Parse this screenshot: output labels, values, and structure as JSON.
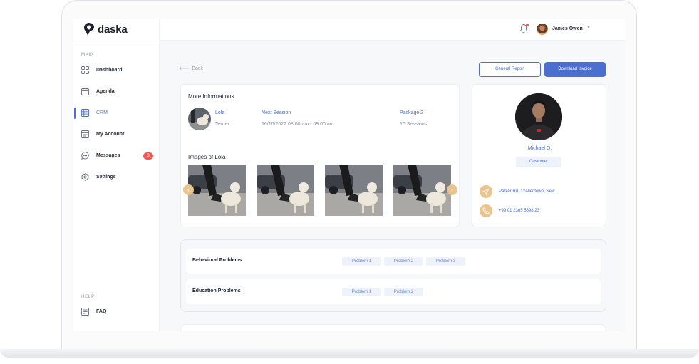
{
  "app": {
    "name": "daska"
  },
  "colors": {
    "accent": "#4a6fd0",
    "badge": "#ef5a57",
    "contact_icon": "#e9c48f",
    "tag_bg": "#eef2fb"
  },
  "sidebar": {
    "main_label": "MAIN",
    "items": [
      {
        "label": "Dashboard",
        "icon": "grid-icon"
      },
      {
        "label": "Agenda",
        "icon": "calendar-icon"
      },
      {
        "label": "CRM",
        "icon": "table-icon",
        "active": true
      },
      {
        "label": "My Account",
        "icon": "account-card-icon"
      },
      {
        "label": "Messages",
        "icon": "chat-icon",
        "badge": "3"
      },
      {
        "label": "Settings",
        "icon": "gear-icon"
      }
    ],
    "help_label": "HELP",
    "help_items": [
      {
        "label": "FAQ",
        "icon": "faq-icon"
      }
    ]
  },
  "header": {
    "user_name": "James Owen",
    "notification_icon": "bell-icon"
  },
  "toolbar": {
    "back_label": "Back",
    "general_report_label": "General Report",
    "download_invoice_label": "Download Invoice"
  },
  "more_info": {
    "title": "More Informations",
    "pet_name": "Lola",
    "pet_breed": "Terrier",
    "next_session_label": "Next Session",
    "next_session_value": "16/10/2022   08:00 am - 09:00 am",
    "package_label": "Package 2",
    "package_value": "10 Sessions",
    "gallery_title": "Images of Lola",
    "gallery_count": 4
  },
  "profile": {
    "name": "Michael O.",
    "role": "Customer",
    "address": "Parker Rd. 12Allentown, New",
    "phone": "+99 01 2365 5698 23"
  },
  "problems": [
    {
      "label": "Behavioral Problems",
      "tags": [
        "Problem 1",
        "Problem 2",
        "Problem 3"
      ]
    },
    {
      "label": "Education Problems",
      "tags": [
        "Problem 1",
        "Problem 2"
      ]
    }
  ]
}
